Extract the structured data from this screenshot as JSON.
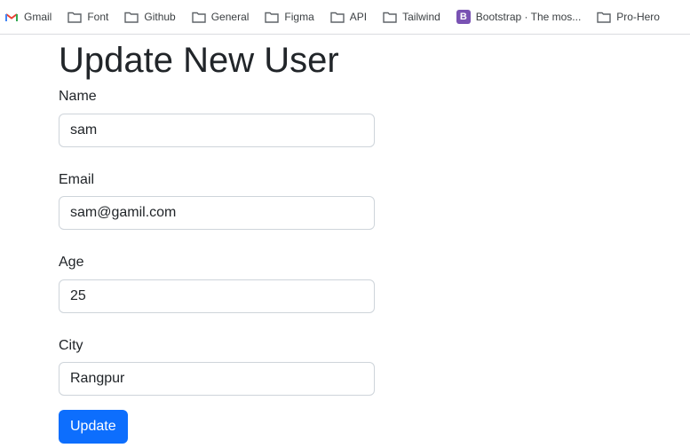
{
  "bookmarks": [
    {
      "label": "Gmail",
      "icon": "gmail-icon"
    },
    {
      "label": "Font",
      "icon": "folder-icon"
    },
    {
      "label": "Github",
      "icon": "folder-icon"
    },
    {
      "label": "General",
      "icon": "folder-icon"
    },
    {
      "label": "Figma",
      "icon": "folder-icon"
    },
    {
      "label": "API",
      "icon": "folder-icon"
    },
    {
      "label": "Tailwind",
      "icon": "folder-icon"
    },
    {
      "label": "Bootstrap · The mos...",
      "icon": "bootstrap-icon"
    },
    {
      "label": "Pro-Hero",
      "icon": "folder-icon"
    }
  ],
  "page": {
    "title": "Update New User",
    "fields": {
      "name": {
        "label": "Name",
        "value": "sam"
      },
      "email": {
        "label": "Email",
        "value": "sam@gamil.com"
      },
      "age": {
        "label": "Age",
        "value": "25"
      },
      "city": {
        "label": "City",
        "value": "Rangpur"
      }
    },
    "submit_label": "Update"
  },
  "colors": {
    "primary": "#0d6efd",
    "bootstrap_brand": "#7952b3"
  }
}
